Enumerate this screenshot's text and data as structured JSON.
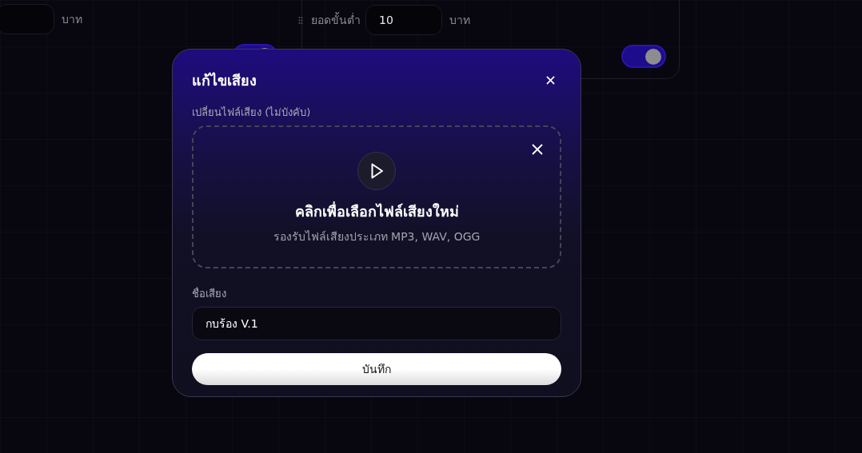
{
  "background": {
    "left_group": {
      "unit": "บาท",
      "toggle": {
        "on": true
      }
    },
    "right_card": {
      "label": "ยอดขั้นต่ำ",
      "value": "10",
      "unit": "บาท",
      "toggle": {
        "on": true
      }
    }
  },
  "dialog": {
    "title": "แก้ไขเสียง",
    "file_label": "เปลี่ยนไฟล์เสียง (ไม่บังคับ)",
    "dropzone": {
      "title": "คลิกเพื่อเลือกไฟล์เสียงใหม่",
      "hint": "รองรับไฟล์เสียงประเภท MP3, WAV, OGG"
    },
    "name_label": "ชื่อเสียง",
    "name_value": "กบร้อง V.1",
    "save_button": "บันทึก"
  }
}
